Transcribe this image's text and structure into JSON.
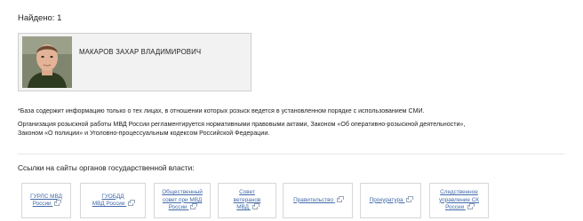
{
  "results": {
    "found_label": "Найдено: 1"
  },
  "person": {
    "name": "МАКАРОВ ЗАХАР ВЛАДИМИРОВИЧ"
  },
  "notes": {
    "database_note": "*База содержит информацию только о тех лицах, в отношении которых розыск ведется в установленном порядке с использованием СМИ.",
    "legal_note_line1": "Организация розыскной работы МВД России регламентируется нормативными правовыми актами, Законом «Об оперативно-розыскной деятельности»,",
    "legal_note_line2": "Законом «О полиции» и Уголовно-процессуальным кодексом Российской Федерации."
  },
  "links_section": {
    "title": "Ссылки на сайты органов государственной власти:",
    "links": [
      {
        "line1": "ГУРЛС МВД",
        "line2": "России"
      },
      {
        "line1": "ГУОБДД",
        "line2": "МВД России"
      },
      {
        "line1": "Общественный",
        "line2": "совет при МВД",
        "line3": "России"
      },
      {
        "line1": "Совет",
        "line2": "ветеранов",
        "line3": "МВД"
      },
      {
        "line1": "Правительство"
      },
      {
        "line1": "Прокуратура"
      },
      {
        "line1": "Следственное",
        "line2": "управление СК",
        "line3": "России"
      }
    ]
  },
  "icons": {
    "external_link": "external-link-icon"
  }
}
